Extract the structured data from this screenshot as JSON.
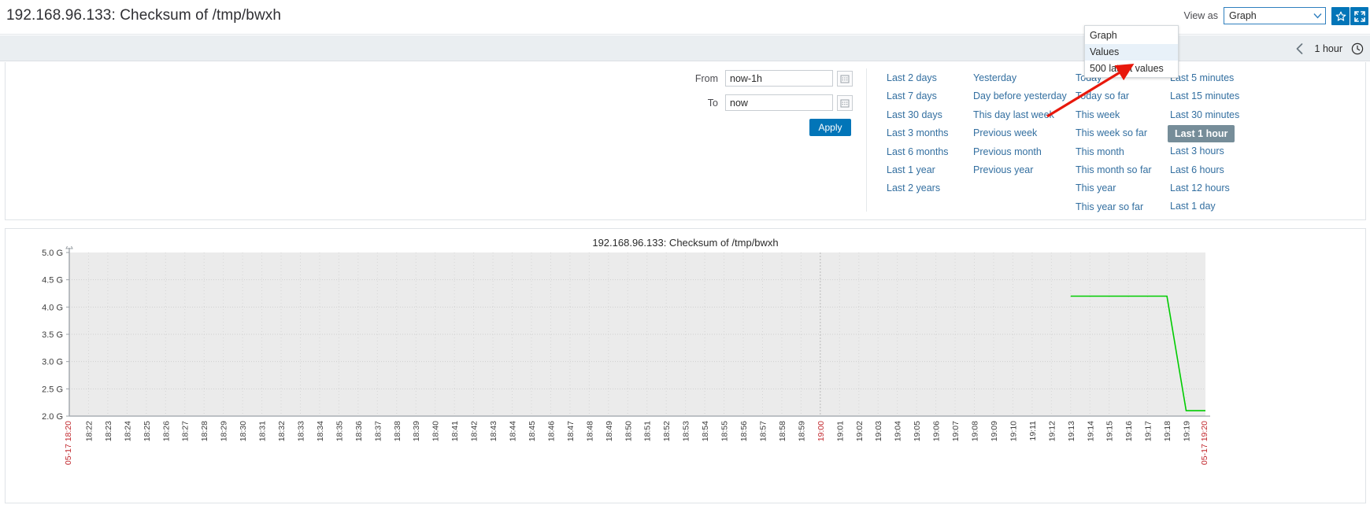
{
  "header": {
    "title": "192.168.96.133: Checksum of /tmp/bwxh",
    "view_as_label": "View as",
    "view_as_value": "Graph",
    "favorite_icon": "star-icon",
    "kiosk_icon": "fullscreen-icon",
    "dropdown_options": [
      {
        "label": "Graph",
        "highlighted": false
      },
      {
        "label": "Values",
        "highlighted": true
      },
      {
        "label": "500 latest values",
        "highlighted": false
      }
    ]
  },
  "timebar": {
    "prev_icon": "chevron-left-icon",
    "range_label": "1 hour",
    "clock_icon": "clock-icon"
  },
  "filter": {
    "from_label": "From",
    "from_value": "now-1h",
    "to_label": "To",
    "to_value": "now",
    "calendar_icon": "calendar-icon",
    "apply_label": "Apply",
    "columns": [
      {
        "items": [
          {
            "label": "Last 2 days",
            "selected": false
          },
          {
            "label": "Last 7 days",
            "selected": false
          },
          {
            "label": "Last 30 days",
            "selected": false
          },
          {
            "label": "Last 3 months",
            "selected": false
          },
          {
            "label": "Last 6 months",
            "selected": false
          },
          {
            "label": "Last 1 year",
            "selected": false
          },
          {
            "label": "Last 2 years",
            "selected": false
          }
        ]
      },
      {
        "items": [
          {
            "label": "Yesterday",
            "selected": false
          },
          {
            "label": "Day before yesterday",
            "selected": false
          },
          {
            "label": "This day last week",
            "selected": false
          },
          {
            "label": "Previous week",
            "selected": false
          },
          {
            "label": "Previous month",
            "selected": false
          },
          {
            "label": "Previous year",
            "selected": false
          }
        ]
      },
      {
        "items": [
          {
            "label": "Today",
            "selected": false
          },
          {
            "label": "Today so far",
            "selected": false
          },
          {
            "label": "This week",
            "selected": false
          },
          {
            "label": "This week so far",
            "selected": false
          },
          {
            "label": "This month",
            "selected": false
          },
          {
            "label": "This month so far",
            "selected": false
          },
          {
            "label": "This year",
            "selected": false
          },
          {
            "label": "This year so far",
            "selected": false
          }
        ]
      },
      {
        "items": [
          {
            "label": "Last 5 minutes",
            "selected": false
          },
          {
            "label": "Last 15 minutes",
            "selected": false
          },
          {
            "label": "Last 30 minutes",
            "selected": false
          },
          {
            "label": "Last 1 hour",
            "selected": true
          },
          {
            "label": "Last 3 hours",
            "selected": false
          },
          {
            "label": "Last 6 hours",
            "selected": false
          },
          {
            "label": "Last 12 hours",
            "selected": false
          },
          {
            "label": "Last 1 day",
            "selected": false
          }
        ]
      }
    ]
  },
  "chart": {
    "title": "192.168.96.133: Checksum of /tmp/bwxh"
  },
  "chart_data": {
    "type": "line",
    "title": "192.168.96.133: Checksum of /tmp/bwxh",
    "xlabel": "",
    "ylabel": "",
    "ylim": [
      2.0,
      5.0
    ],
    "ytick_labels": [
      "5.0 G",
      "4.5 G",
      "4.0 G",
      "3.5 G",
      "3.0 G",
      "2.5 G",
      "2.0 G"
    ],
    "ytick_values": [
      5.0,
      4.5,
      4.0,
      3.5,
      3.0,
      2.5,
      2.0
    ],
    "grid": true,
    "legend": "none",
    "line_color": "#00cc00",
    "x_start_label": "05-17 18:20",
    "x_end_label": "05-17 19:20",
    "xtick_labels": [
      "18:22",
      "18:23",
      "18:24",
      "18:25",
      "18:26",
      "18:27",
      "18:28",
      "18:29",
      "18:30",
      "18:31",
      "18:32",
      "18:33",
      "18:34",
      "18:35",
      "18:36",
      "18:37",
      "18:38",
      "18:39",
      "18:40",
      "18:41",
      "18:42",
      "18:43",
      "18:44",
      "18:45",
      "18:46",
      "18:47",
      "18:48",
      "18:49",
      "18:50",
      "18:51",
      "18:52",
      "18:53",
      "18:54",
      "18:55",
      "18:56",
      "18:57",
      "18:58",
      "18:59",
      "19:00",
      "19:01",
      "19:02",
      "19:03",
      "19:04",
      "19:05",
      "19:06",
      "19:07",
      "19:08",
      "19:09",
      "19:10",
      "19:11",
      "19:12",
      "19:13",
      "19:14",
      "19:15",
      "19:16",
      "19:17",
      "19:18",
      "19:19"
    ],
    "highlight_xticks": [
      "19:00"
    ],
    "series": [
      {
        "name": "Checksum of /tmp/bwxh",
        "color": "#00cc00",
        "points": [
          {
            "x": "19:13",
            "y": 4.2
          },
          {
            "x": "19:14",
            "y": 4.2
          },
          {
            "x": "19:15",
            "y": 4.2
          },
          {
            "x": "19:16",
            "y": 4.2
          },
          {
            "x": "19:17",
            "y": 4.2
          },
          {
            "x": "19:18",
            "y": 4.2
          },
          {
            "x": "19:19",
            "y": 2.1
          },
          {
            "x": "19:20",
            "y": 2.1
          }
        ]
      }
    ]
  }
}
